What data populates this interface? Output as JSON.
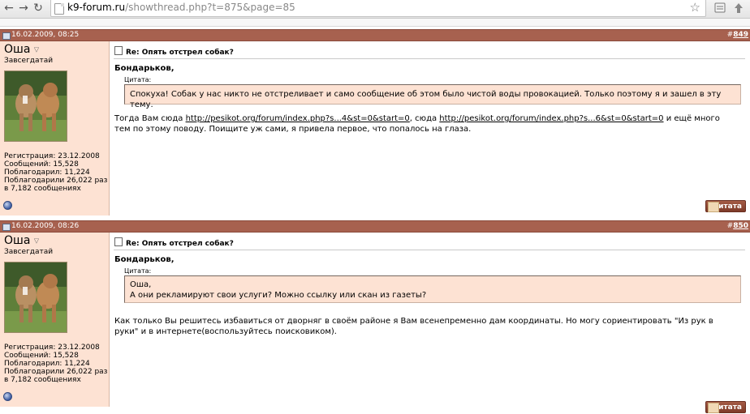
{
  "browser": {
    "url_host": "k9-forum.ru",
    "url_path": "/showthread.php?t=875&page=85",
    "icons": {
      "back": "back-arrow-icon",
      "forward": "forward-arrow-icon",
      "reload": "reload-icon",
      "home": "home-icon",
      "star": "star-icon",
      "wrench": "wrench-icon",
      "page": "page-icon"
    }
  },
  "colors": {
    "header": "#a7614f",
    "user_bg": "#fde2d3",
    "quote_bg": "#fde2d3"
  },
  "posts": [
    {
      "date": "16.02.2009, 08:25",
      "number": "849",
      "hash": "#",
      "username": "Оша",
      "rank": "Завсегдатай",
      "stats": {
        "reg": "Регистрация: 23.12.2008",
        "msgs": "Сообщений: 15,528",
        "thanked": "Поблагодарил: 11,224",
        "was_thanked": "Поблагодарили 26,022 раз в 7,182 сообщениях"
      },
      "title": "Re: Опять отстрел собак?",
      "reply_to": "Бондарьков,",
      "quote_label": "Цитата:",
      "quote_lines": [
        "Спокуха! Собак у нас никто не отстреливает и само сообщение об этом было чистой воды провокацией. Только поэтому я и зашел в эту тему."
      ],
      "body": {
        "p1": "Тогда Вам сюда ",
        "link1": "http://pesikot.org/forum/index.php?s...4&st=0&start=0",
        "p2": ", сюда ",
        "link2": "http://pesikot.org/forum/index.php?s...6&st=0&start=0",
        "p3": " и ещё много тем по этому поводу. Поищите уж сами, я привела первое, что попалось на глаза."
      },
      "quote_button": "Цитата"
    },
    {
      "date": "16.02.2009, 08:26",
      "number": "850",
      "hash": "#",
      "username": "Оша",
      "rank": "Завсегдатай",
      "stats": {
        "reg": "Регистрация: 23.12.2008",
        "msgs": "Сообщений: 15,528",
        "thanked": "Поблагодарил: 11,224",
        "was_thanked": "Поблагодарили 26,022 раз в 7,182 сообщениях"
      },
      "title": "Re: Опять отстрел собак?",
      "reply_to": "Бондарьков,",
      "quote_label": "Цитата:",
      "quote_lines": [
        "Оша,",
        "А они рекламируют свои услуги? Можно ссылку или скан из газеты?"
      ],
      "body": {
        "text": "Как только Вы решитесь избавиться от дворняг в своём районе я Вам всенепременно дам координаты. Но могу сориентировать \"Из рук в руки\" и в интернете(воспользуйтесь поисковиком)."
      },
      "quote_button": "Цитата"
    }
  ]
}
